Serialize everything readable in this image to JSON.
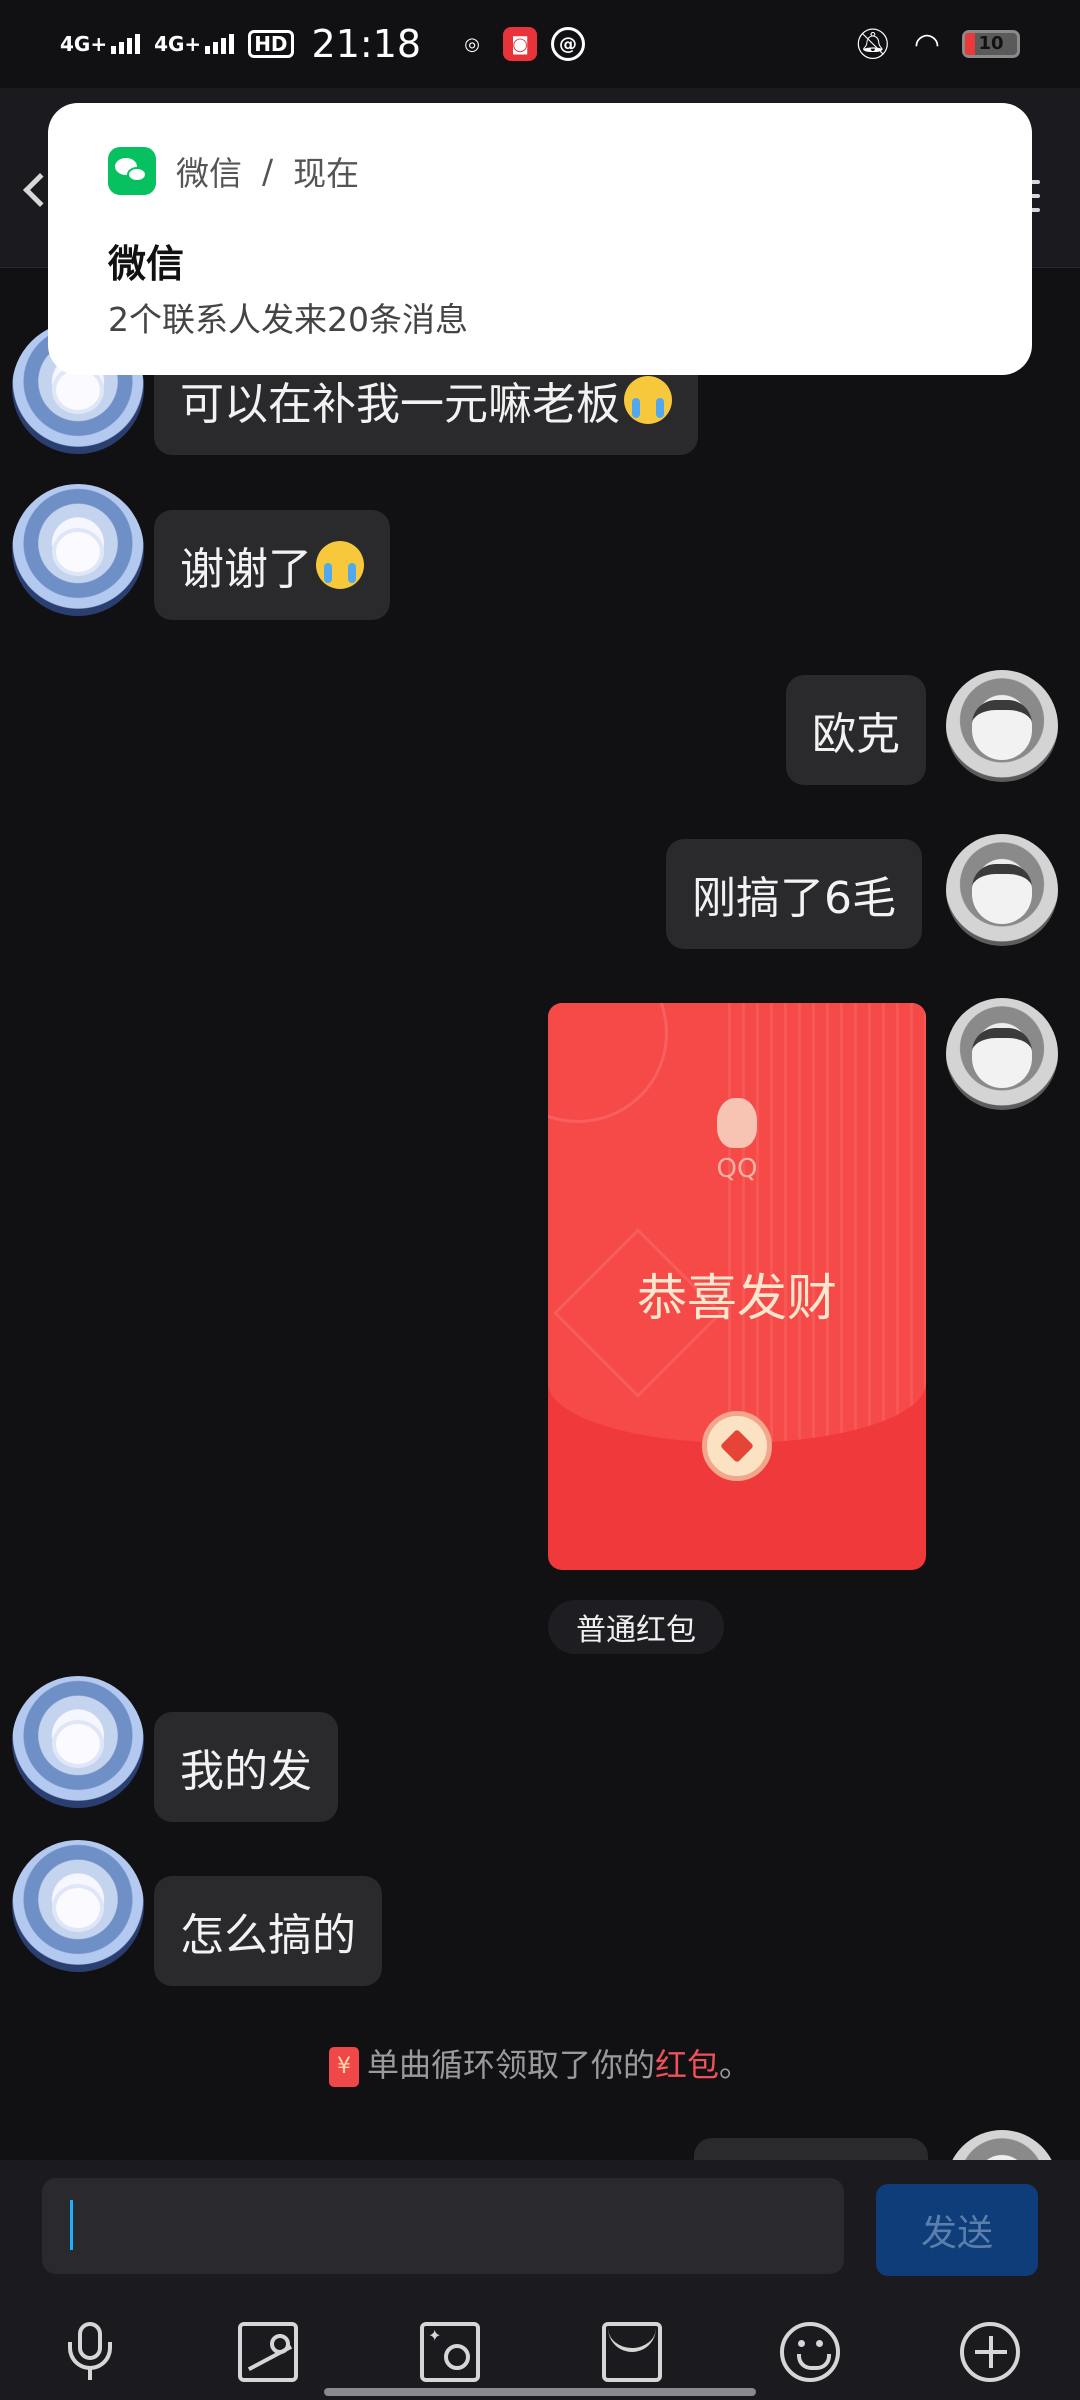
{
  "status_bar": {
    "net1": "4G+",
    "net2": "4G+",
    "hd": "HD",
    "time": "21:18",
    "battery": "10"
  },
  "notification": {
    "app_name": "微信",
    "separator": "/",
    "time": "现在",
    "title": "微信",
    "body": "2个联系人发来20条消息"
  },
  "messages": [
    {
      "side": "left",
      "text": "可以在补我一元嘛老板",
      "emoji": "loudly-crying-face"
    },
    {
      "side": "left",
      "text": "谢谢了",
      "emoji": "loudly-crying-face"
    },
    {
      "side": "right",
      "text": "欧克"
    },
    {
      "side": "right",
      "text": "刚搞了6毛"
    },
    {
      "side": "left",
      "text": "我的发"
    },
    {
      "side": "left",
      "text": "怎么搞的"
    }
  ],
  "red_packet": {
    "brand": "QQ",
    "greeting": "恭喜发财",
    "type_label": "普通红包",
    "color": "#f0393a"
  },
  "system_notice": {
    "prefix": "单曲循环领取了你的",
    "highlight": "红包",
    "suffix": "。",
    "icon_glyph": "¥"
  },
  "input": {
    "value": "",
    "placeholder": "",
    "send_label": "发送"
  },
  "toolbar": {
    "items": [
      "microphone-icon",
      "image-icon",
      "camera-icon",
      "red-packet-icon",
      "emoji-icon",
      "plus-icon"
    ]
  }
}
